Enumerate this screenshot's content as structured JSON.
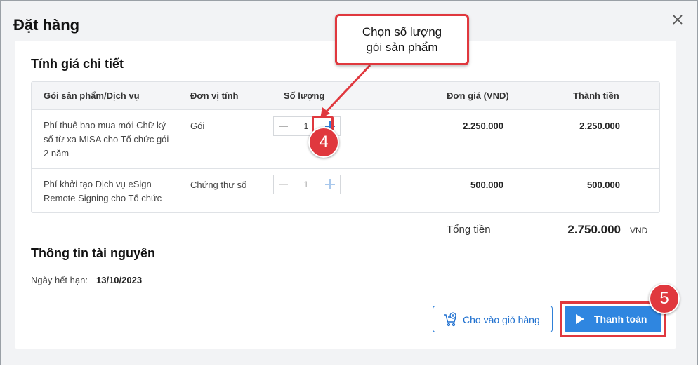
{
  "dialog": {
    "title": "Đặt hàng",
    "close_icon": "close-icon"
  },
  "pricing": {
    "title": "Tính giá chi tiết",
    "columns": [
      "Gói sản phẩm/Dịch vụ",
      "Đơn vị tính",
      "Số lượng",
      "Đơn giá (VND)",
      "Thành tiền"
    ],
    "rows": [
      {
        "product_lines": [
          "Phí thuê bao mua mới Chữ ký",
          "số từ xa MISA cho Tổ chức gói",
          "2 năm"
        ],
        "unit": "Gói",
        "quantity": "1",
        "price": "2.250.000",
        "total": "2.250.000"
      },
      {
        "product_lines": [
          "Phí khởi tạo Dịch vụ eSign",
          "Remote Signing cho Tổ chức"
        ],
        "unit": "Chứng thư số",
        "quantity": "1",
        "price": "500.000",
        "total": "500.000"
      }
    ],
    "total_label": "Tổng tiền",
    "total_value": "2.750.000",
    "total_unit": "VND"
  },
  "resource": {
    "title": "Thông tin tài nguyên",
    "expiry_label": "Ngày hết hạn:",
    "expiry_value": "13/10/2023"
  },
  "actions": {
    "add_to_cart": "Cho vào giỏ hàng",
    "pay": "Thanh toán"
  },
  "annotations": {
    "callout_lines": [
      "Chọn số lượng",
      "gói sản phẩm"
    ],
    "step_qty": "4",
    "step_pay": "5"
  },
  "colors": {
    "accent": "#2f86e0",
    "highlight": "#e0383e"
  }
}
